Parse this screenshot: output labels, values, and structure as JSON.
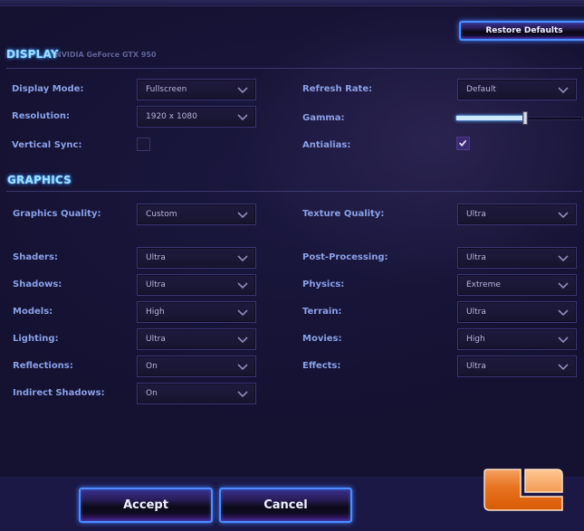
{
  "header": {
    "restore_defaults_label": "Restore Defaults"
  },
  "display": {
    "title": "DISPLAY",
    "gpu_name": "NVIDIA GeForce GTX 950",
    "display_mode": {
      "label": "Display Mode:",
      "value": "Fullscreen"
    },
    "resolution": {
      "label": "Resolution:",
      "value": "1920 x 1080"
    },
    "vertical_sync": {
      "label": "Vertical Sync:",
      "checked": false
    },
    "refresh_rate": {
      "label": "Refresh Rate:",
      "value": "Default"
    },
    "gamma": {
      "label": "Gamma:",
      "value_fraction": 0.54
    },
    "antialias": {
      "label": "Antialias:",
      "checked": true
    }
  },
  "graphics": {
    "title": "GRAPHICS",
    "graphics_quality": {
      "label": "Graphics Quality:",
      "value": "Custom"
    },
    "texture_quality": {
      "label": "Texture Quality:",
      "value": "Ultra"
    },
    "left": [
      {
        "label": "Shaders:",
        "value": "Ultra"
      },
      {
        "label": "Shadows:",
        "value": "Ultra"
      },
      {
        "label": "Models:",
        "value": "High"
      },
      {
        "label": "Lighting:",
        "value": "Ultra"
      },
      {
        "label": "Reflections:",
        "value": "On"
      },
      {
        "label": "Indirect Shadows:",
        "value": "On"
      }
    ],
    "right": [
      {
        "label": "Post-Processing:",
        "value": "Ultra"
      },
      {
        "label": "Physics:",
        "value": "Extreme"
      },
      {
        "label": "Terrain:",
        "value": "Ultra"
      },
      {
        "label": "Movies:",
        "value": "High"
      },
      {
        "label": "Effects:",
        "value": "Ultra"
      }
    ]
  },
  "footer": {
    "accept_label": "Accept",
    "cancel_label": "Cancel"
  },
  "icons": {
    "dropdown": "chevron-down-icon",
    "check": "checkmark-icon",
    "logo": "site-logo"
  },
  "colors": {
    "background": "#131030",
    "accent_glow": "#4e8dff",
    "label": "#8aa0e6",
    "section_title": "#9fe0ff",
    "logo_orange": "#e8650f"
  }
}
